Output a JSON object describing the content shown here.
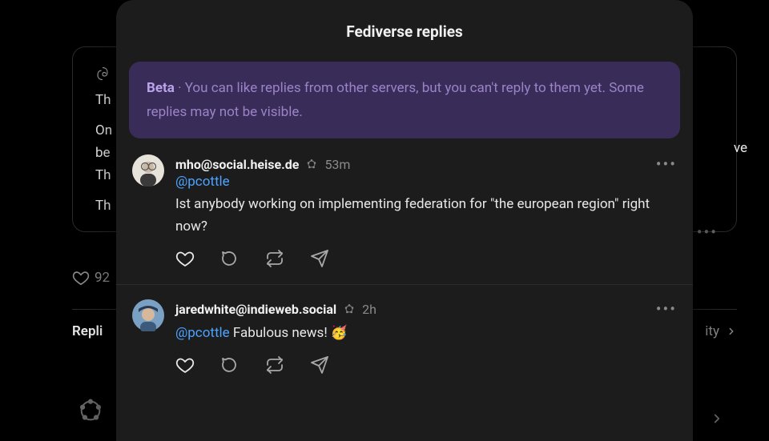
{
  "background": {
    "line2": "Th",
    "paragraph": "On",
    "paragraph2": "be",
    "paragraph3": "Th",
    "paragraph4": "Th",
    "likes": "92",
    "repliesLabel": "Repli",
    "activityLabel": "ity",
    "rightTrail": "ve"
  },
  "modal": {
    "title": "Fediverse replies",
    "banner": {
      "beta": "Beta",
      "sep": " · ",
      "text": "You can like replies from other servers, but you can't reply to them yet. Some replies may not be visible."
    },
    "replies": [
      {
        "user": "mho@social.heise.de",
        "time": "53m",
        "mention": "@pcottle",
        "text": "Ist anybody working on implementing federation for \"the european region\" right now?"
      },
      {
        "user": "jaredwhite@indieweb.social",
        "time": "2h",
        "mention": "@pcottle",
        "text": "Fabulous news! 🥳"
      }
    ]
  },
  "icons": {
    "fediverse": "fediverse-icon",
    "heart": "heart-icon",
    "comment": "comment-icon",
    "repost": "repost-icon",
    "send": "send-icon",
    "more": "more-icon",
    "chevron": "chevron-right-icon"
  }
}
